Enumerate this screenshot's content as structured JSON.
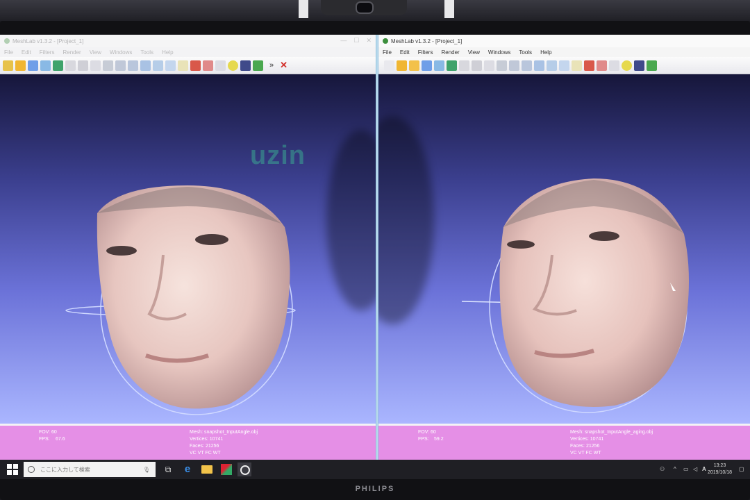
{
  "left_window": {
    "title": "MeshLab v1.3.2 - [Project_1]",
    "menu": [
      "File",
      "Edit",
      "Filters",
      "Render",
      "View",
      "Windows",
      "Tools",
      "Help"
    ],
    "overflow_label": "»",
    "info": {
      "fov": "FOV: 60",
      "fps_label": "FPS:",
      "fps_value": "67.6",
      "mesh": "Mesh: snapshot_InputAngle.obj",
      "vertices": "Vertices: 10741",
      "faces": "Faces: 21256",
      "flags": "VC VT FC WT"
    }
  },
  "right_window": {
    "title": "MeshLab v1.3.2 - [Project_1]",
    "menu": [
      "File",
      "Edit",
      "Filters",
      "Render",
      "View",
      "Windows",
      "Tools",
      "Help"
    ],
    "overflow_label": "»",
    "info": {
      "fov": "FOV: 60",
      "fps_label": "FPS:",
      "fps_value": "59.2",
      "mesh": "Mesh: snapshot_InputAngle_aging.obj",
      "vertices": "Vertices: 10741",
      "faces": "Faces: 21256",
      "flags": "VC VT FC WT"
    }
  },
  "background_sign": "uzin",
  "taskbar": {
    "search_placeholder": "ここに入力して検索",
    "time": "13:23",
    "date": "2019/10/18",
    "ime": "A"
  },
  "monitor_brand": "PHILIPS",
  "colors": {
    "info_bar": "#e58fe6",
    "viewport_top": "#16163a",
    "viewport_bottom": "#aab6ff"
  }
}
